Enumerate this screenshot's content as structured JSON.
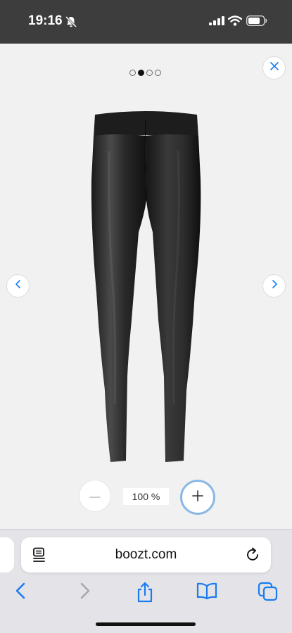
{
  "status_bar": {
    "time": "19:16",
    "icons": [
      "bell-slash-icon",
      "signal-icon",
      "wifi-icon",
      "battery-icon"
    ]
  },
  "gallery": {
    "image_count": 4,
    "active_index": 1,
    "product_image": "black-leggings"
  },
  "zoom": {
    "level_label": "100 %"
  },
  "browser": {
    "url": "boozt.com",
    "toolbar": [
      "back",
      "forward",
      "share",
      "bookmarks",
      "tabs"
    ]
  },
  "colors": {
    "status_bar_bg": "#3d3d3d",
    "viewer_bg": "#f1f1f1",
    "accent_blue": "#1a7cf0",
    "zoom_plus_ring": "#8ab8e6",
    "toolbar_bg": "#e4e4e8"
  }
}
